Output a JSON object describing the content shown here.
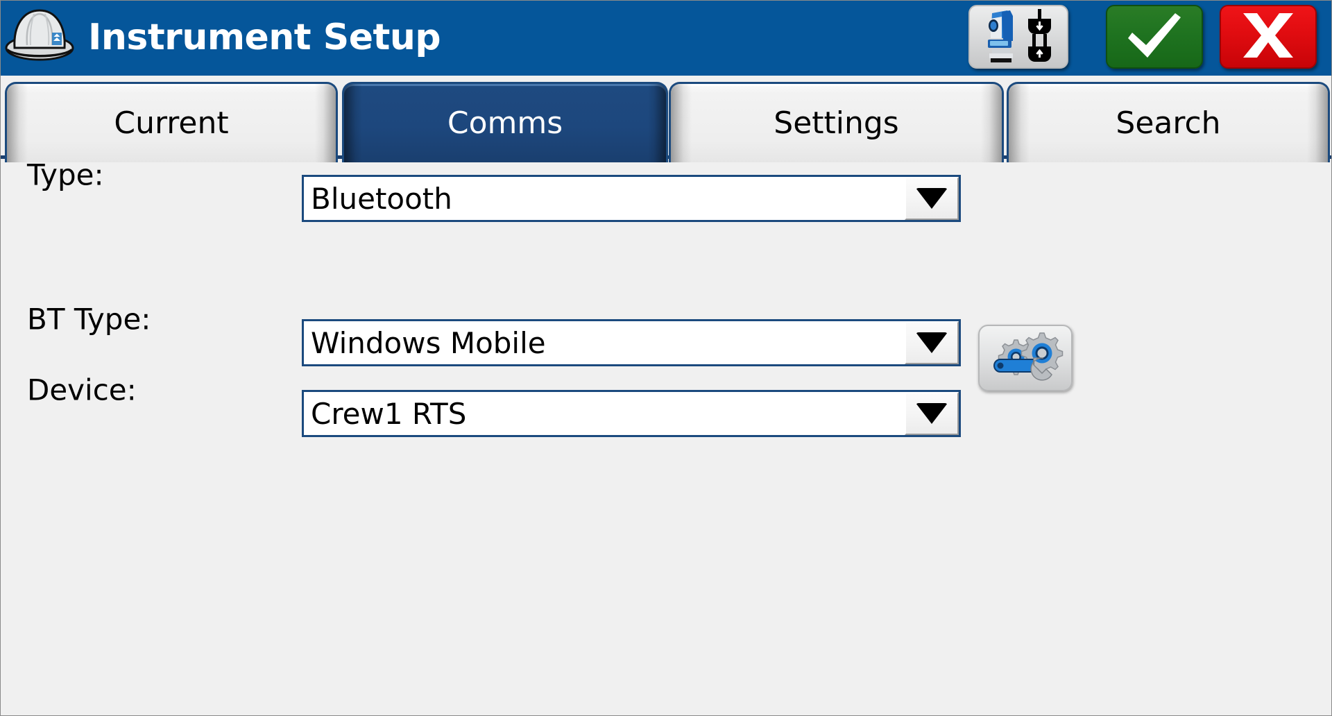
{
  "window": {
    "title": "Instrument Setup",
    "logo_icon": "hard-hat-icon",
    "titlebar_color": "#05569a"
  },
  "titlebar_buttons": [
    {
      "name": "instrument-connect-button",
      "icon": "total-station-connect-icon",
      "label": ""
    },
    {
      "name": "accept-button",
      "icon": "checkmark-icon",
      "label": "",
      "color": "#1f7320"
    },
    {
      "name": "cancel-button",
      "icon": "close-x-icon",
      "label": "",
      "color": "#e00c10"
    }
  ],
  "tabs": [
    {
      "label": "Current",
      "active": false
    },
    {
      "label": "Comms",
      "active": true
    },
    {
      "label": "Settings",
      "active": false
    },
    {
      "label": "Search",
      "active": false
    }
  ],
  "form": {
    "fields": [
      {
        "label": "Type:",
        "value": "Bluetooth",
        "control": "dropdown"
      },
      {
        "label": "BT Type:",
        "value": "Windows Mobile",
        "control": "dropdown"
      },
      {
        "label": "Device:",
        "value": "Crew1 RTS",
        "control": "dropdown"
      }
    ],
    "config_button": {
      "name": "bluetooth-config-button",
      "icon": "gears-wrench-icon"
    }
  },
  "colors": {
    "titlebar_blue": "#05569a",
    "active_tab_blue": "#1d477d",
    "tab_border": "#1b4a7e",
    "page_background": "#f0f0f0",
    "accept_green": "#1f7320",
    "cancel_red": "#e00c10"
  }
}
